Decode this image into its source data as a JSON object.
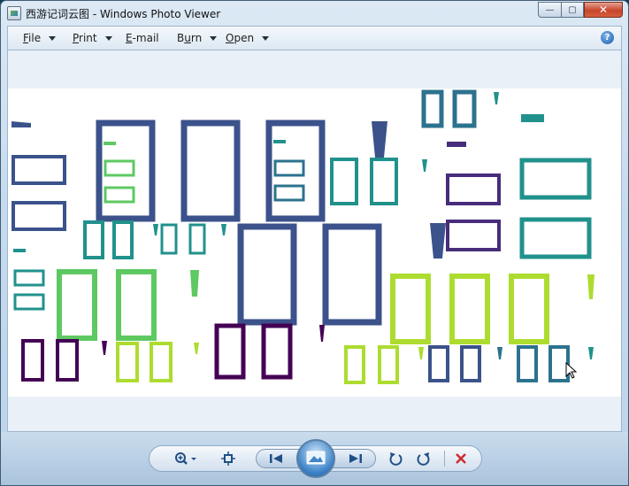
{
  "window": {
    "title": "西游记词云图 - Windows Photo Viewer",
    "controls": {
      "minimize": "—",
      "maximize": "▢",
      "close": "✕"
    }
  },
  "menu": {
    "file": {
      "label": "File",
      "key": "F",
      "rest": "ile"
    },
    "print": {
      "label": "Print",
      "key": "P",
      "rest": "rint"
    },
    "email": {
      "label": "E-mail",
      "key": "E",
      "rest": "-mail"
    },
    "burn": {
      "label": "Burn",
      "key": "u",
      "pre": "B",
      "rest": "rn"
    },
    "open": {
      "label": "Open",
      "key": "O",
      "rest": "pen"
    },
    "help": "?"
  },
  "toolbar": {
    "zoom_icon": "magnifier-plus-icon",
    "fit_icon": "actual-size-icon",
    "prev_icon": "previous-icon",
    "slideshow_icon": "slideshow-icon",
    "next_icon": "next-icon",
    "rotate_ccw_icon": "rotate-counterclockwise-icon",
    "rotate_cw_icon": "rotate-clockwise-icon",
    "delete_icon": "delete-icon"
  },
  "colors": {
    "palette": [
      "#440154",
      "#472d7b",
      "#3b528b",
      "#2c728e",
      "#21918c",
      "#28ae80",
      "#5ec962",
      "#addc30"
    ]
  }
}
